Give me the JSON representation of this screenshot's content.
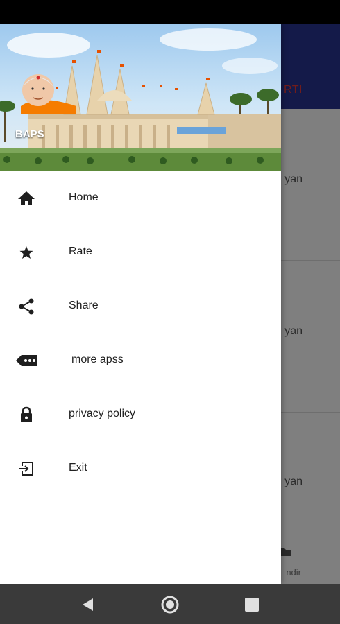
{
  "background_app": {
    "toolbar_text": "RTI",
    "rows": [
      {
        "text": "yan"
      },
      {
        "text": "yan"
      },
      {
        "text": "yan"
      }
    ],
    "bottom_tab_label": "ndir"
  },
  "drawer": {
    "header_title": "BAPS",
    "items": [
      {
        "label": "Home",
        "icon": "home-icon"
      },
      {
        "label": "Rate",
        "icon": "star-icon"
      },
      {
        "label": "Share",
        "icon": "share-icon"
      },
      {
        "label": "more apss",
        "icon": "more-apps-icon"
      },
      {
        "label": "privacy policy",
        "icon": "lock-icon"
      },
      {
        "label": "Exit",
        "icon": "exit-icon"
      }
    ]
  },
  "colors": {
    "toolbar": "#283593",
    "accent_text": "#e53935",
    "drawer_bg": "#ffffff",
    "nav_bar": "#3a3a3a"
  },
  "system_nav": {
    "buttons": [
      "back",
      "home",
      "recents"
    ]
  }
}
